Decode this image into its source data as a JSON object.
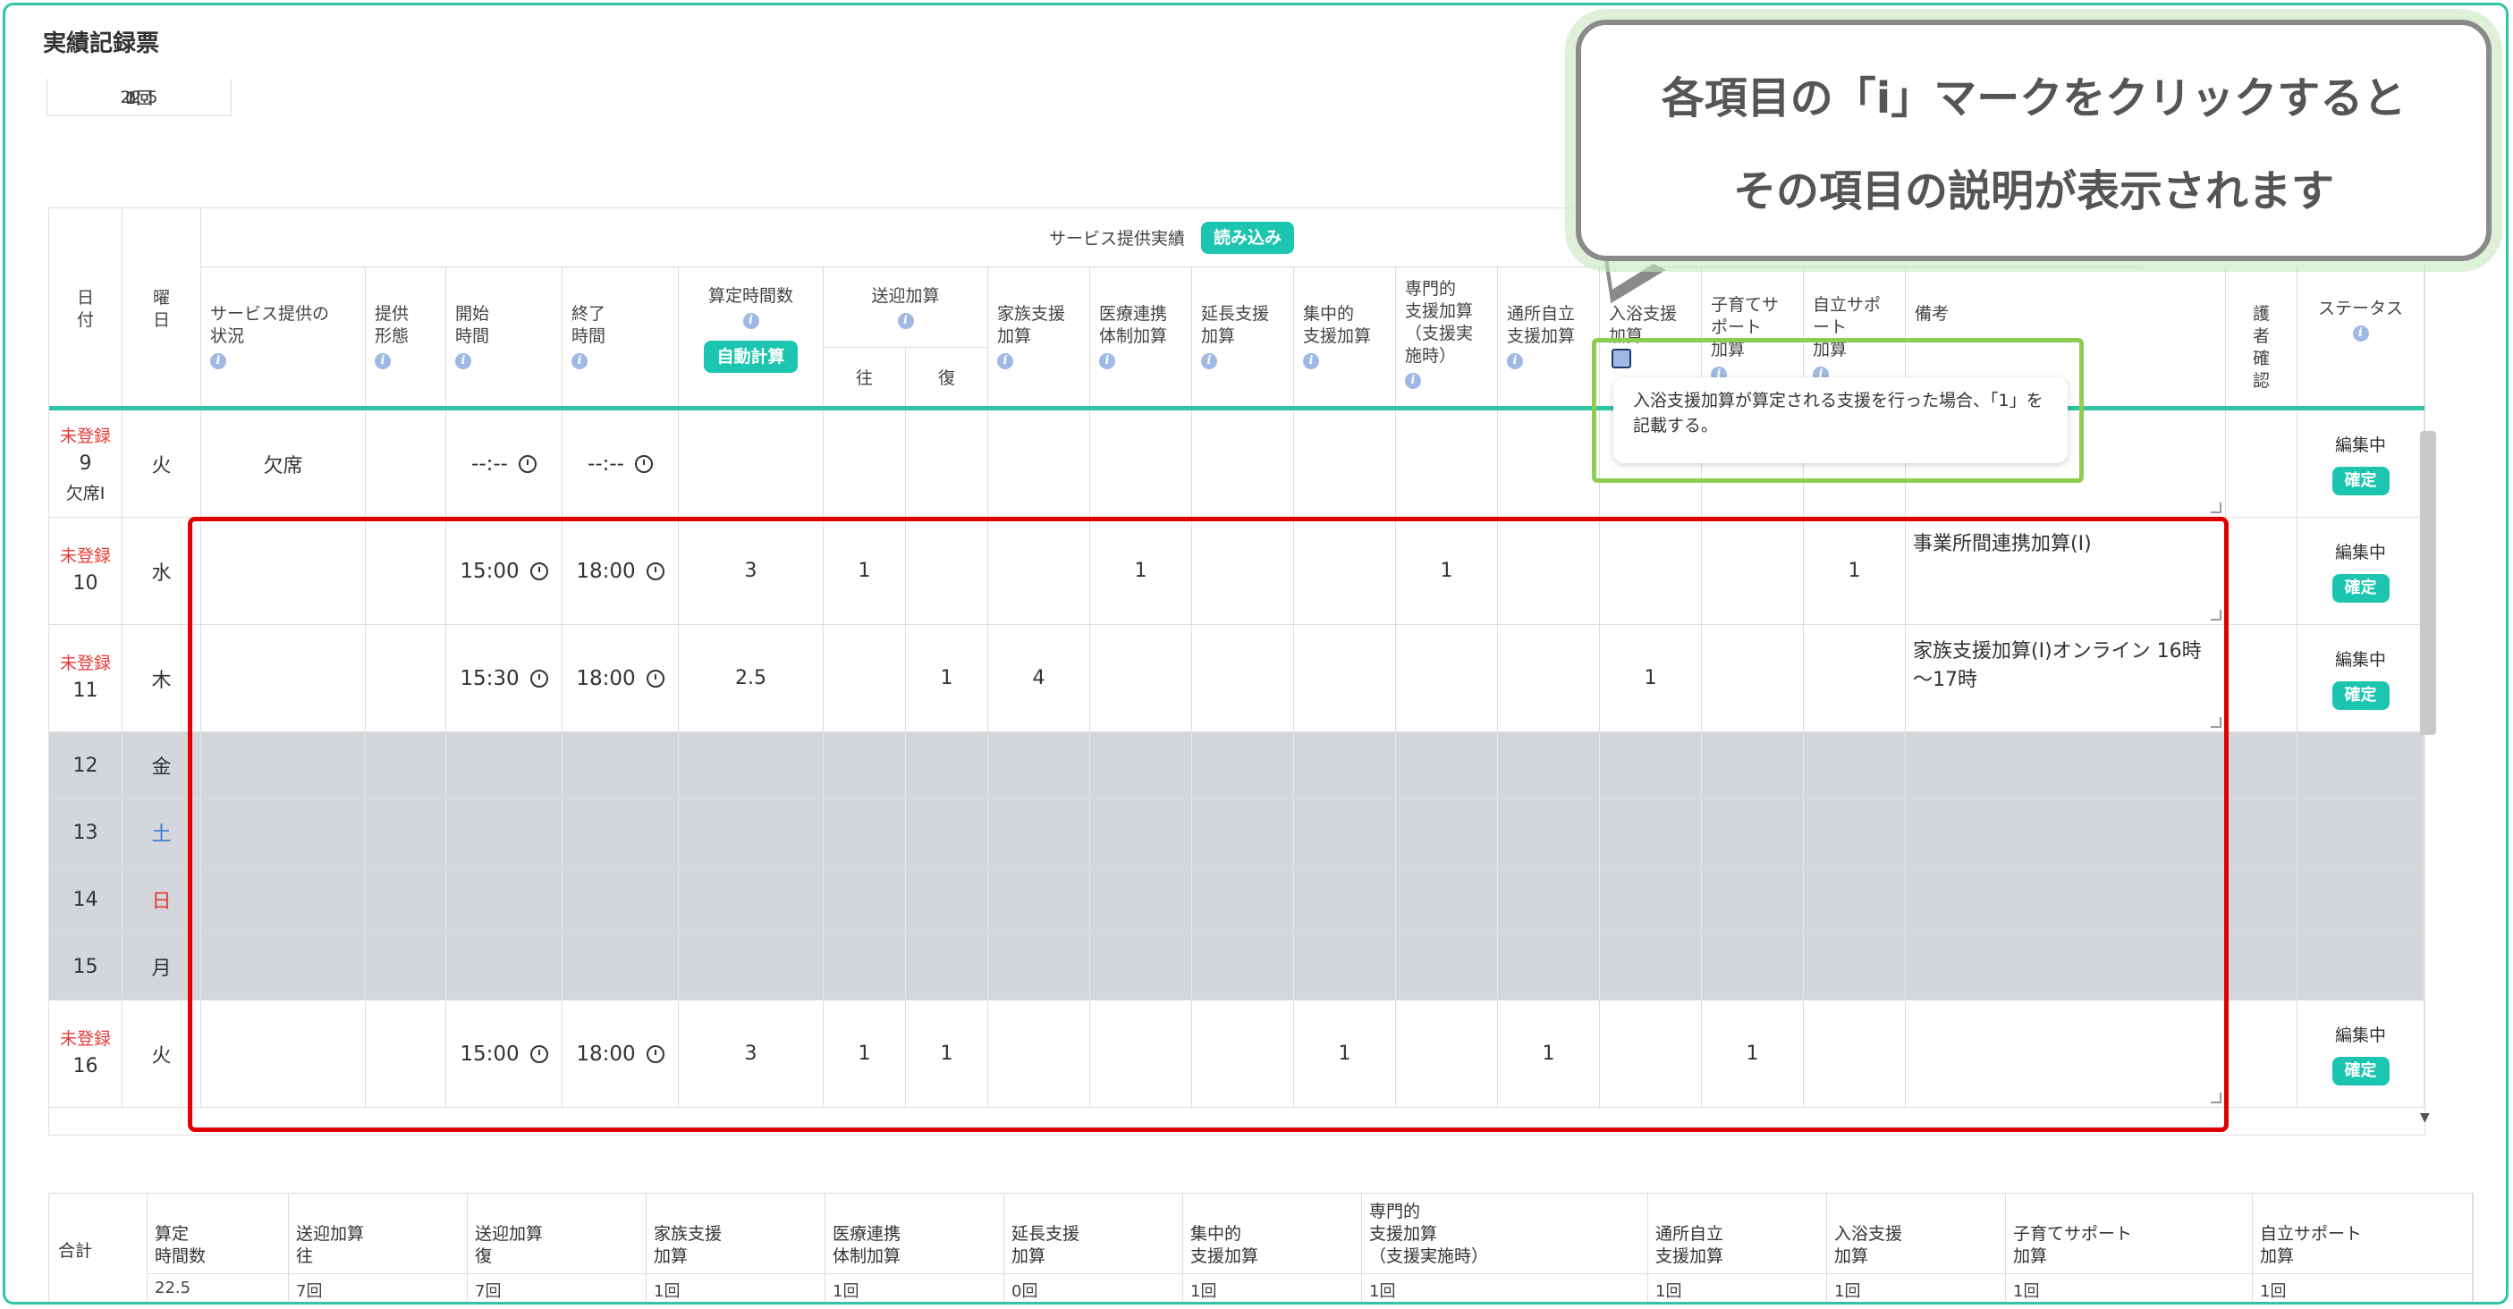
{
  "page_title": "実績記録票",
  "top_summary": [
    "22.5",
    "7回",
    "7回",
    "1回",
    "1回",
    "0回",
    "1回",
    "1回"
  ],
  "header": {
    "day": "日\n付",
    "weekday": "曜\n日",
    "supply_title": "サービス提供実績",
    "load_button": "読み込み",
    "service_status": "サービス提供の\n状況",
    "form": "提供\n形態",
    "start": "開始\n時間",
    "end": "終了\n時間",
    "calc_hours": "算定時間数",
    "auto_calc": "自動計算",
    "transport": "送迎加算",
    "transport_out": "往",
    "transport_back": "復",
    "family": "家族支援\n加算",
    "medical": "医療連携\n体制加算",
    "extension": "延長支援\n加算",
    "intensive": "集中的\n支援加算",
    "specialist": "専門的\n支援加算\n（支援実\n施時）",
    "commute": "通所自立\n支援加算",
    "bath": "入浴支援\n加算",
    "childcare": "子育てサ\nポート\n加算",
    "independence": "自立サポ\nート\n加算",
    "remarks": "備考",
    "guardian": "護\n者\n確\n認",
    "status": "ステータス"
  },
  "rows": [
    {
      "unreg": "未登録",
      "day": "9",
      "sub": "欠席Ⅰ",
      "wd": "火",
      "wdColor": "#333",
      "service": "欠席",
      "start": "--:--",
      "end": "--:--",
      "hours": "",
      "out": "",
      "back": "",
      "family": "",
      "medical": "",
      "ext": "",
      "intensive": "",
      "specialist": "",
      "commute": "",
      "bath": "",
      "childcare": "",
      "indep": "",
      "memo": "",
      "status": "編集中",
      "confirm": "確定",
      "gray": false
    },
    {
      "unreg": "未登録",
      "day": "10",
      "sub": "",
      "wd": "水",
      "wdColor": "#333",
      "service": "",
      "start": "15:00",
      "end": "18:00",
      "hours": "3",
      "out": "1",
      "back": "",
      "family": "",
      "medical": "1",
      "ext": "",
      "intensive": "",
      "specialist": "1",
      "commute": "",
      "bath": "",
      "childcare": "",
      "indep": "1",
      "memo": "事業所間連携加算(Ⅰ)",
      "status": "編集中",
      "confirm": "確定",
      "gray": false
    },
    {
      "unreg": "未登録",
      "day": "11",
      "sub": "",
      "wd": "木",
      "wdColor": "#333",
      "service": "",
      "start": "15:30",
      "end": "18:00",
      "hours": "2.5",
      "out": "",
      "back": "1",
      "family": "4",
      "medical": "",
      "ext": "",
      "intensive": "",
      "specialist": "",
      "commute": "",
      "bath": "1",
      "childcare": "",
      "indep": "",
      "memo": "家族支援加算(Ⅰ)オンライン 16時～17時",
      "status": "編集中",
      "confirm": "確定",
      "gray": false
    },
    {
      "unreg": "",
      "day": "12",
      "sub": "",
      "wd": "金",
      "wdColor": "#333",
      "gray": true
    },
    {
      "unreg": "",
      "day": "13",
      "sub": "",
      "wd": "土",
      "wdColor": "#3a7bd5",
      "gray": true
    },
    {
      "unreg": "",
      "day": "14",
      "sub": "",
      "wd": "日",
      "wdColor": "#e53935",
      "gray": true
    },
    {
      "unreg": "",
      "day": "15",
      "sub": "",
      "wd": "月",
      "wdColor": "#333",
      "gray": true
    },
    {
      "unreg": "未登録",
      "day": "16",
      "sub": "",
      "wd": "火",
      "wdColor": "#333",
      "service": "",
      "start": "15:00",
      "end": "18:00",
      "hours": "3",
      "out": "1",
      "back": "1",
      "family": "",
      "medical": "",
      "ext": "",
      "intensive": "1",
      "specialist": "",
      "commute": "1",
      "bath": "",
      "childcare": "1",
      "indep": "",
      "memo": "",
      "status": "編集中",
      "confirm": "確定",
      "gray": false
    }
  ],
  "callout": {
    "line1": "各項目の「i」マークをクリックすると",
    "line2": "その項目の説明が表示されます"
  },
  "tooltip": "入浴支援加算が算定される支援を行った場合、「1」を記載する。",
  "totals": {
    "label": "合計",
    "columns": [
      {
        "h": "算定\n時間数",
        "v": "22.5"
      },
      {
        "h": "送迎加算\n往",
        "v": "7回"
      },
      {
        "h": "送迎加算\n復",
        "v": "7回"
      },
      {
        "h": "家族支援\n加算",
        "v": "1回"
      },
      {
        "h": "医療連携\n体制加算",
        "v": "1回"
      },
      {
        "h": "延長支援\n加算",
        "v": "0回"
      },
      {
        "h": "集中的\n支援加算",
        "v": "1回"
      },
      {
        "h": "専門的\n支援加算\n（支援実施時）",
        "v": "1回"
      },
      {
        "h": "通所自立\n支援加算",
        "v": "1回"
      },
      {
        "h": "入浴支援\n加算",
        "v": "1回"
      },
      {
        "h": "子育てサポート\n加算",
        "v": "1回"
      },
      {
        "h": "自立サポート\n加算",
        "v": "1回"
      }
    ]
  },
  "colors": {
    "accent": "#2ec4a6",
    "button": "#1cc5b0",
    "highlight": "#e10000",
    "tooltip_border": "#8dcd52",
    "unregistered": "#e53935"
  }
}
